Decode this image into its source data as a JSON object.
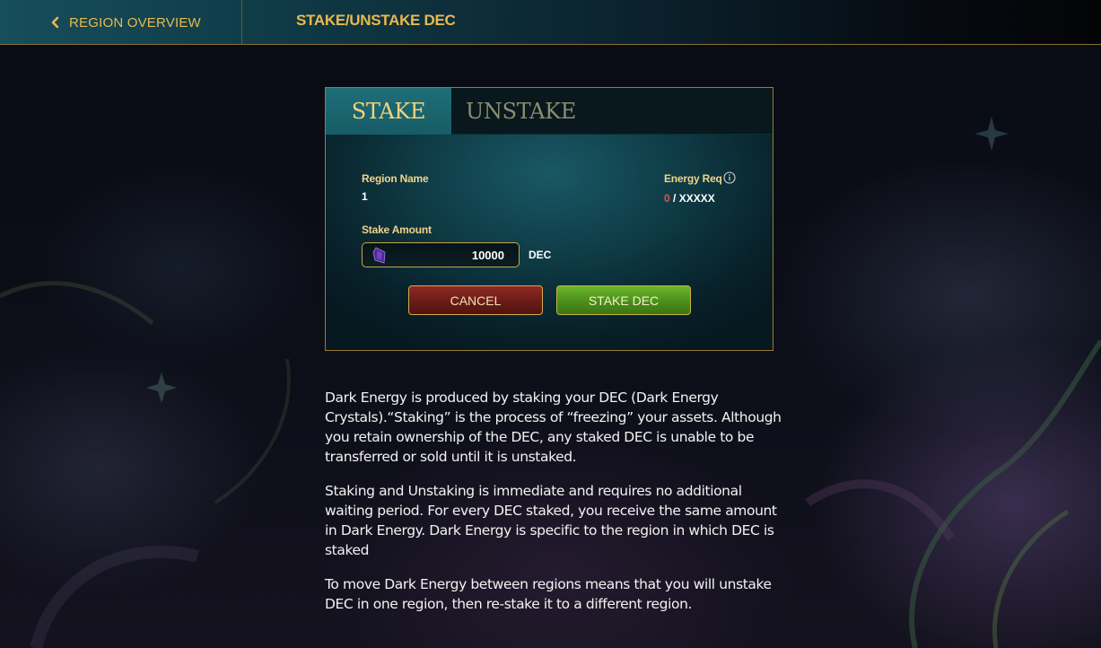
{
  "header": {
    "back_label": "REGION OVERVIEW",
    "title": "STAKE/UNSTAKE DEC"
  },
  "tabs": [
    {
      "label": "STAKE",
      "active": true
    },
    {
      "label": "UNSTAKE",
      "active": false
    }
  ],
  "form": {
    "region_name_label": "Region Name",
    "region_name_value": "1",
    "energy_req_label": "Energy Req",
    "energy_current": "0",
    "energy_total": " / XXXXX",
    "stake_amount_label": "Stake Amount",
    "stake_amount_value": "10000",
    "stake_unit": "DEC",
    "cancel_label": "CANCEL",
    "submit_label": "STAKE DEC"
  },
  "description": [
    "Dark Energy is produced by staking your DEC (Dark Energy Crystals).“Staking” is the process of “freezing” your assets. Although you retain ownership of the DEC, any staked DEC is unable to be transferred or sold until it is unstaked.",
    "Staking and Unstaking is immediate and requires no additional waiting period. For every DEC staked, you receive the same amount in Dark Energy. Dark Energy is specific to the region in which DEC is staked",
    "To move Dark Energy between regions means that you will unstake DEC in one region, then re-stake it to a different region."
  ],
  "colors": {
    "accent_gold": "#e9b94f",
    "energy_current": "#e0524d",
    "cancel_bg": "#6a1c18",
    "submit_bg": "#4c8f1b"
  },
  "icons": {
    "back": "chevron-left-icon",
    "info": "info-icon",
    "currency": "dec-crystal-icon"
  }
}
